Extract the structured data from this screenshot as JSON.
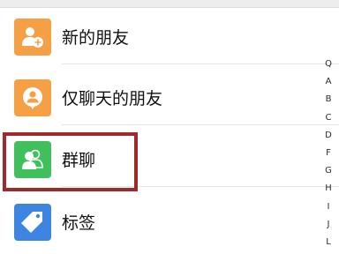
{
  "contacts": {
    "items": [
      {
        "label": "新的朋友",
        "icon": "add-friend-icon",
        "color": "#F5A044"
      },
      {
        "label": "仅聊天的朋友",
        "icon": "chat-only-friend-icon",
        "color": "#F5A044"
      },
      {
        "label": "群聊",
        "icon": "group-chat-icon",
        "color": "#3FC05C"
      },
      {
        "label": "标签",
        "icon": "tag-icon",
        "color": "#3D85E0"
      }
    ]
  },
  "index_bar": {
    "letters": [
      "Q",
      "A",
      "B",
      "C",
      "D",
      "F",
      "G",
      "H",
      "I",
      "J",
      "L"
    ]
  },
  "colors": {
    "highlight": "#A3282B"
  }
}
